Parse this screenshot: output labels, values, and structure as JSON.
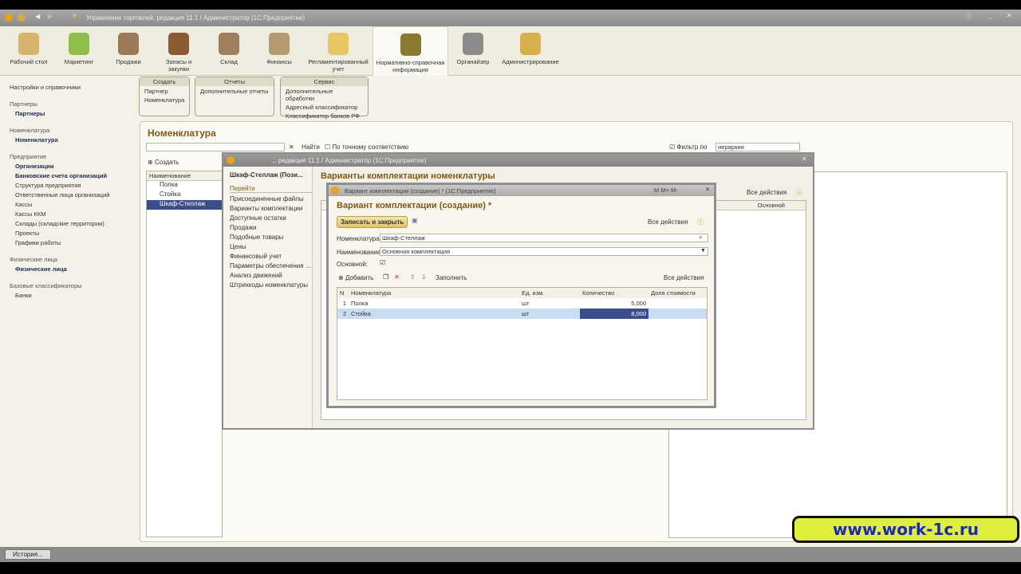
{
  "window": {
    "title": "Управление торговлей, редакция 11.1 / Администратор (1С:Предприятие)"
  },
  "sections": [
    {
      "label": "Рабочий стол",
      "color": "#d8b36a"
    },
    {
      "label": "Маркетинг",
      "color": "#8fbf4a"
    },
    {
      "label": "Продажи",
      "color": "#9b7a55"
    },
    {
      "label": "Запасы и закупки",
      "color": "#8a5a32"
    },
    {
      "label": "Склад",
      "color": "#a0805a"
    },
    {
      "label": "Финансы",
      "color": "#b49a70"
    },
    {
      "label": "Регламентированный учет",
      "color": "#e8c766"
    },
    {
      "label": "Нормативно-справочная информация",
      "color": "#8a7a30"
    },
    {
      "label": "Органайзер",
      "color": "#8b8b8b"
    },
    {
      "label": "Администрирование",
      "color": "#d8b04a"
    }
  ],
  "leftnav": {
    "top": "Настройки и справочники",
    "groups": [
      {
        "title": "Партнеры",
        "items": [
          {
            "label": "Партнеры",
            "bold": true
          }
        ]
      },
      {
        "title": "Номенклатура",
        "items": [
          {
            "label": "Номенклатура",
            "bold": true
          }
        ]
      },
      {
        "title": "Предприятие",
        "items": [
          {
            "label": "Организации",
            "bold": true
          },
          {
            "label": "Банковские счета организаций",
            "bold": true
          },
          {
            "label": "Структура предприятия"
          },
          {
            "label": "Ответственные лица организаций"
          },
          {
            "label": "Кассы"
          },
          {
            "label": "Кассы ККМ"
          },
          {
            "label": "Склады (складские территории)"
          },
          {
            "label": "Проекты"
          },
          {
            "label": "Графики работы"
          }
        ]
      },
      {
        "title": "Физические лица",
        "items": [
          {
            "label": "Физические лица",
            "bold": true
          }
        ]
      },
      {
        "title": "Базовые классификаторы",
        "items": [
          {
            "label": "Банки"
          }
        ]
      }
    ]
  },
  "commands": {
    "create": {
      "title": "Создать",
      "items": [
        "Партнер",
        "Номенклатура"
      ]
    },
    "reports": {
      "title": "Отчеты",
      "items": [
        "Дополнительные отчеты"
      ]
    },
    "service": {
      "title": "Сервис",
      "items": [
        "Дополнительные обработки",
        "Адресный классификатор",
        "Классификатор банков РФ"
      ]
    }
  },
  "main": {
    "title": "Номенклатура",
    "find": "Найти",
    "exact": "По точному соответствию",
    "filter_label": "Фильтр по",
    "filter_value": "иерархии",
    "create": "Создать",
    "col": "Наименование",
    "rows": [
      "Полка",
      "Стойка",
      "Шкаф-Стеллаж"
    ]
  },
  "mid": {
    "title": "... редакция 11.1 / Администратор (1С:Предприятие)",
    "left_title": "Шкаф-Стеллаж (Пози...",
    "goto": "Перейти",
    "links": [
      "Присоединенные файлы",
      "Варианты комплектации",
      "Доступные остатки",
      "Продажи",
      "Подобные товары",
      "Цены",
      "Финансовый учет",
      "Параметры обеспечения ...",
      "Анализ движений",
      "Штрихкоды номенклатуры"
    ],
    "heading": "Варианты комплектации номенклатуры",
    "all_actions": "Все действия",
    "col_main": "Основной"
  },
  "dialog": {
    "title": "Вариант комплектации (создание) * (1С:Предприятие)",
    "heading": "Вариант комплектации (создание) *",
    "save_close": "Записать и закрыть",
    "all_actions": "Все действия",
    "nom_label": "Номенклатура:",
    "nom_value": "Шкаф-Стеллаж",
    "name_label": "Наименование:",
    "name_value": "Основная комплектация",
    "main_label": "Основной:",
    "add": "Добавить",
    "fill": "Заполнить",
    "cols": [
      "N",
      "Номенклатура",
      "Ед. изм.",
      "Количество",
      "Доля стоимости"
    ],
    "rows": [
      [
        "1",
        "Полка",
        "шт",
        "5,000",
        ""
      ],
      [
        "2",
        "Стойка",
        "шт",
        "8,000",
        ""
      ]
    ]
  },
  "status": {
    "history": "История..."
  },
  "banner": "www.work-1c.ru"
}
